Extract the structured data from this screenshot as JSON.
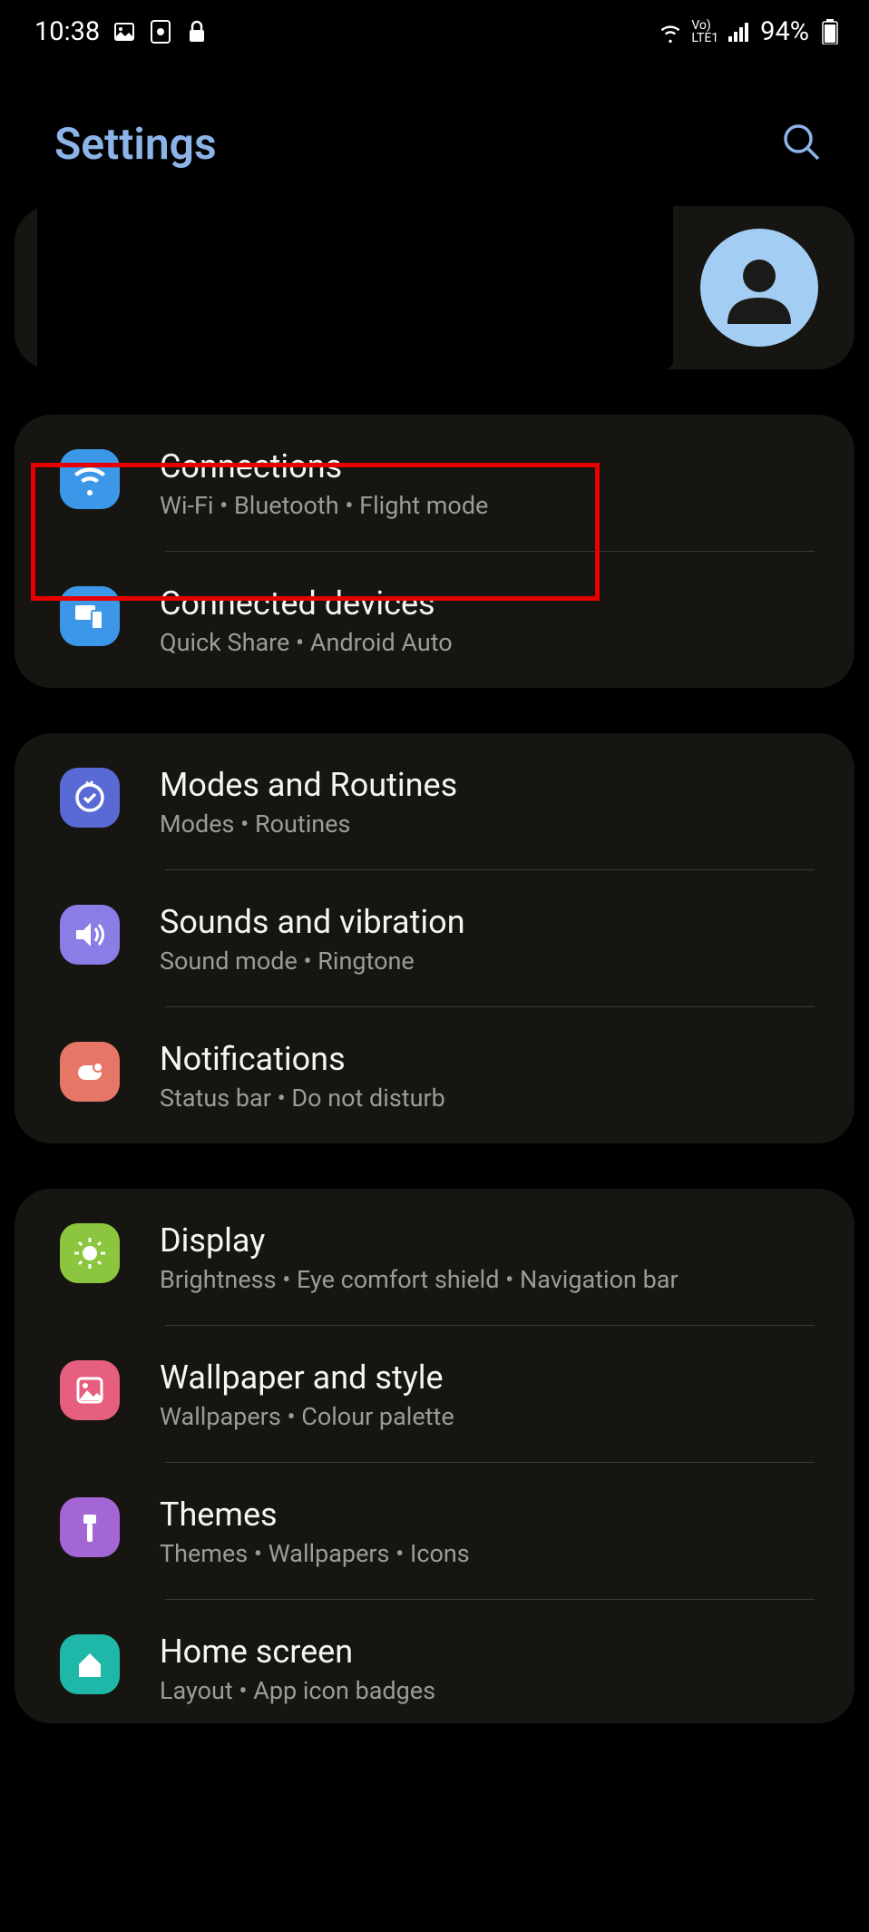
{
  "status_bar": {
    "time": "10:38",
    "battery": "94%",
    "network_label": "Vo)\nLTE1"
  },
  "header": {
    "title": "Settings"
  },
  "groups": [
    {
      "items": [
        {
          "id": "connections",
          "title": "Connections",
          "subtitle": "Wi-Fi  •  Bluetooth  •  Flight mode",
          "icon_color": "icon-blue",
          "highlighted": true
        },
        {
          "id": "connected-devices",
          "title": "Connected devices",
          "subtitle": "Quick Share  •  Android Auto",
          "icon_color": "icon-blue2"
        }
      ]
    },
    {
      "items": [
        {
          "id": "modes-routines",
          "title": "Modes and Routines",
          "subtitle": "Modes  •  Routines",
          "icon_color": "icon-indigo"
        },
        {
          "id": "sounds-vibration",
          "title": "Sounds and vibration",
          "subtitle": "Sound mode  •  Ringtone",
          "icon_color": "icon-lavender"
        },
        {
          "id": "notifications",
          "title": "Notifications",
          "subtitle": "Status bar  •  Do not disturb",
          "icon_color": "icon-coral"
        }
      ]
    },
    {
      "items": [
        {
          "id": "display",
          "title": "Display",
          "subtitle": "Brightness  •  Eye comfort shield  •  Navigation bar",
          "icon_color": "icon-green"
        },
        {
          "id": "wallpaper-style",
          "title": "Wallpaper and style",
          "subtitle": "Wallpapers  •  Colour palette",
          "icon_color": "icon-pink"
        },
        {
          "id": "themes",
          "title": "Themes",
          "subtitle": "Themes  •  Wallpapers  •  Icons",
          "icon_color": "icon-purple"
        },
        {
          "id": "home-screen",
          "title": "Home screen",
          "subtitle": "Layout  •  App icon badges",
          "icon_color": "icon-teal"
        }
      ]
    }
  ]
}
